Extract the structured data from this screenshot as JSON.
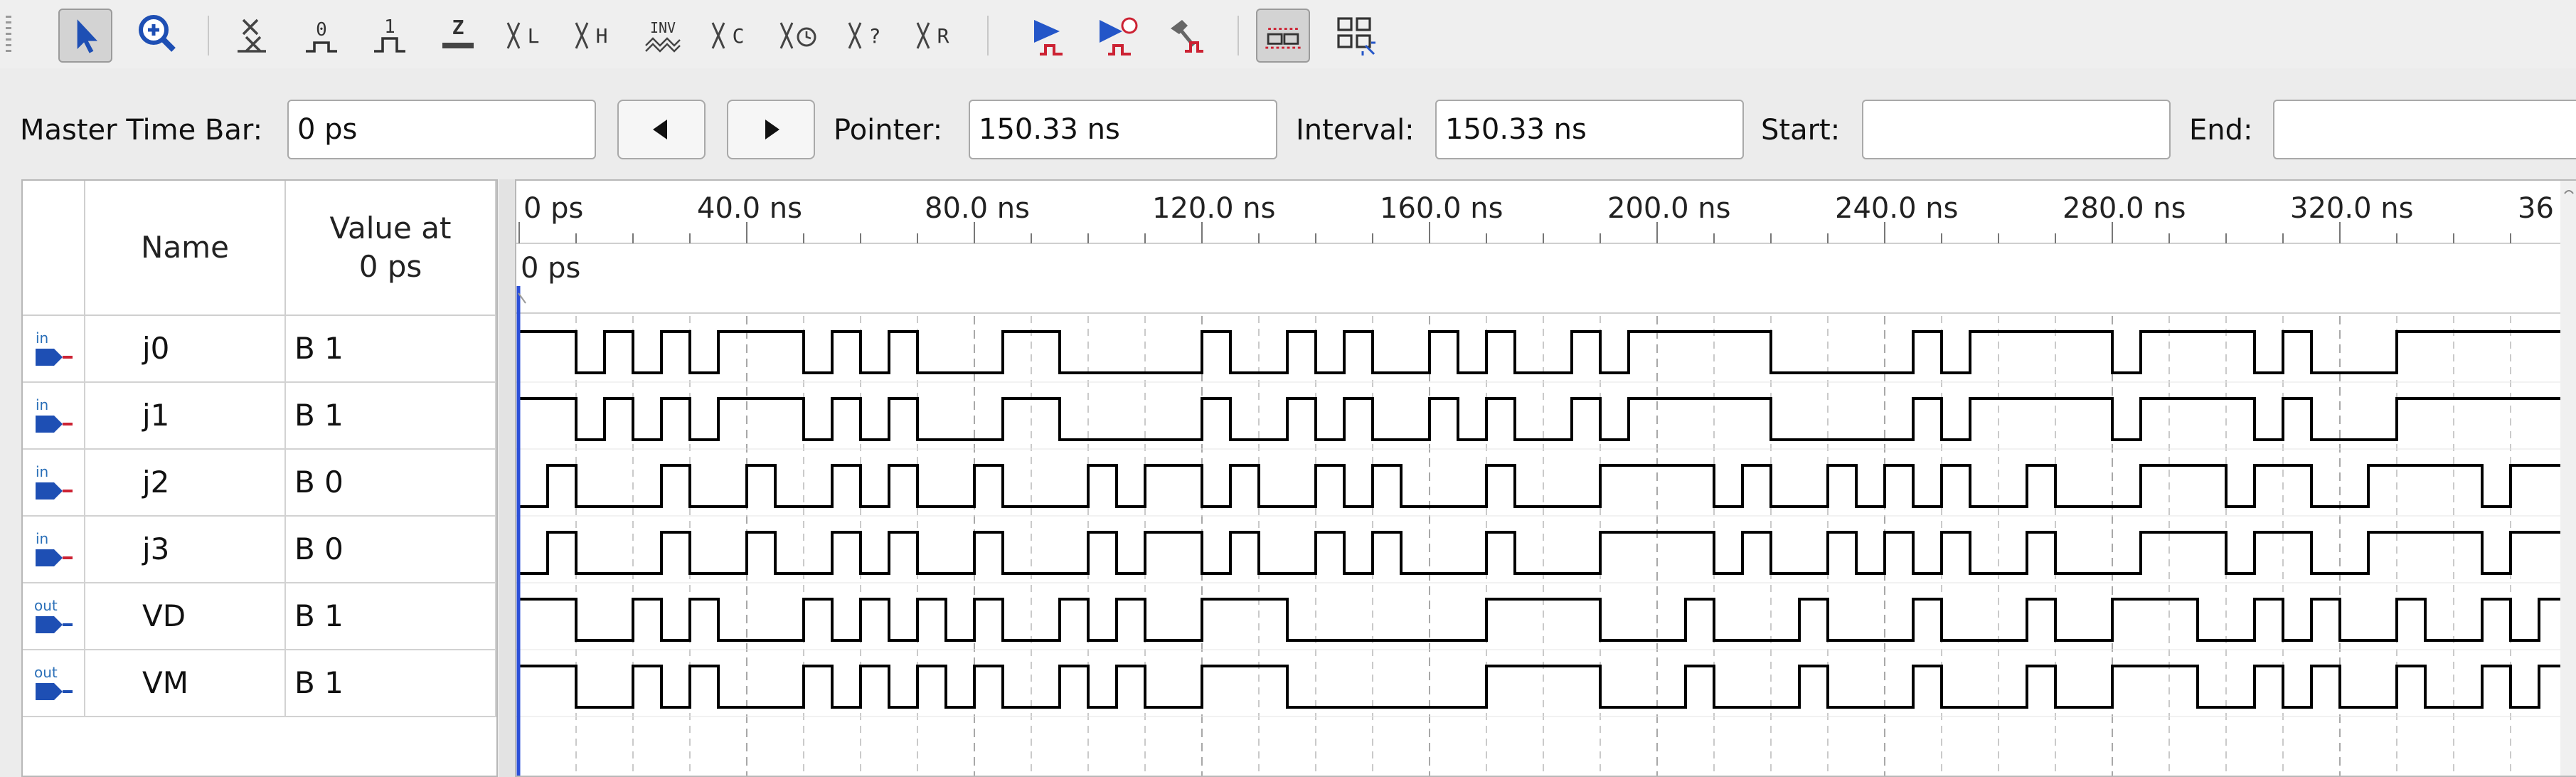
{
  "toolbar": {
    "tools": [
      "selection-tool",
      "zoom-tool",
      "uninitialized",
      "forcing-low",
      "forcing-high",
      "high-impedance",
      "weak-low",
      "weak-high",
      "invert",
      "count-value",
      "clock",
      "random",
      "arbitrary-value",
      "run-functional-simulation",
      "run-timing-simulation",
      "generate-testbench",
      "snap-to-grid",
      "sort-group"
    ],
    "glyphs": {
      "forcing_low": "0",
      "forcing_high": "1",
      "high_z": "Z",
      "weak_low": "L",
      "weak_high": "H",
      "invert": "INV",
      "count": "C",
      "random": "?",
      "arbitrary": "R"
    }
  },
  "timebar": {
    "master_label": "Master Time Bar:",
    "master_value": "0 ps",
    "pointer_label": "Pointer:",
    "pointer_value": "150.33 ns",
    "interval_label": "Interval:",
    "interval_value": "150.33 ns",
    "start_label": "Start:",
    "start_value": "",
    "end_label": "End:",
    "end_value": ""
  },
  "table": {
    "col_name": "Name",
    "col_value": "Value at\n0 ps",
    "signals": [
      {
        "dir": "in",
        "name": "j0",
        "value": "B 1"
      },
      {
        "dir": "in",
        "name": "j1",
        "value": "B 1"
      },
      {
        "dir": "in",
        "name": "j2",
        "value": "B 0"
      },
      {
        "dir": "in",
        "name": "j3",
        "value": "B 0"
      },
      {
        "dir": "out",
        "name": "VD",
        "value": "B 1"
      },
      {
        "dir": "out",
        "name": "VM",
        "value": "B 1"
      }
    ]
  },
  "waveform": {
    "time_labels": [
      "0 ps",
      "40.0 ns",
      "80.0 ns",
      "120.0 ns",
      "160.0 ns",
      "200.0 ns",
      "240.0 ns",
      "280.0 ns",
      "320.0 ns",
      "36"
    ],
    "cursor_label": "0 ps",
    "ns_per_label": 40,
    "visible_end_ns": 356,
    "traces": {
      "j0": [
        [
          0,
          1
        ],
        [
          10,
          0
        ],
        [
          15,
          1
        ],
        [
          20,
          0
        ],
        [
          25,
          1
        ],
        [
          30,
          0
        ],
        [
          35,
          1
        ],
        [
          50,
          0
        ],
        [
          55,
          1
        ],
        [
          60,
          0
        ],
        [
          65,
          1
        ],
        [
          70,
          0
        ],
        [
          85,
          1
        ],
        [
          95,
          0
        ],
        [
          120,
          1
        ],
        [
          125,
          0
        ],
        [
          135,
          1
        ],
        [
          140,
          0
        ],
        [
          145,
          1
        ],
        [
          150,
          0
        ],
        [
          160,
          1
        ],
        [
          165,
          0
        ],
        [
          170,
          1
        ],
        [
          175,
          0
        ],
        [
          185,
          1
        ],
        [
          190,
          0
        ],
        [
          195,
          1
        ],
        [
          220,
          0
        ],
        [
          245,
          1
        ],
        [
          250,
          0
        ],
        [
          255,
          1
        ],
        [
          280,
          0
        ],
        [
          285,
          1
        ],
        [
          305,
          0
        ],
        [
          310,
          1
        ],
        [
          315,
          0
        ],
        [
          330,
          1
        ],
        [
          360,
          0
        ]
      ],
      "j1": [
        [
          0,
          1
        ],
        [
          10,
          0
        ],
        [
          15,
          1
        ],
        [
          20,
          0
        ],
        [
          25,
          1
        ],
        [
          30,
          0
        ],
        [
          35,
          1
        ],
        [
          50,
          0
        ],
        [
          55,
          1
        ],
        [
          60,
          0
        ],
        [
          65,
          1
        ],
        [
          70,
          0
        ],
        [
          85,
          1
        ],
        [
          95,
          0
        ],
        [
          120,
          1
        ],
        [
          125,
          0
        ],
        [
          135,
          1
        ],
        [
          140,
          0
        ],
        [
          145,
          1
        ],
        [
          150,
          0
        ],
        [
          160,
          1
        ],
        [
          165,
          0
        ],
        [
          170,
          1
        ],
        [
          175,
          0
        ],
        [
          185,
          1
        ],
        [
          190,
          0
        ],
        [
          195,
          1
        ],
        [
          220,
          0
        ],
        [
          245,
          1
        ],
        [
          250,
          0
        ],
        [
          255,
          1
        ],
        [
          280,
          0
        ],
        [
          285,
          1
        ],
        [
          305,
          0
        ],
        [
          310,
          1
        ],
        [
          315,
          0
        ],
        [
          330,
          1
        ],
        [
          360,
          0
        ]
      ],
      "j2": [
        [
          0,
          0
        ],
        [
          5,
          1
        ],
        [
          10,
          0
        ],
        [
          25,
          1
        ],
        [
          30,
          0
        ],
        [
          40,
          1
        ],
        [
          45,
          0
        ],
        [
          55,
          1
        ],
        [
          60,
          0
        ],
        [
          65,
          1
        ],
        [
          70,
          0
        ],
        [
          80,
          1
        ],
        [
          85,
          0
        ],
        [
          100,
          1
        ],
        [
          105,
          0
        ],
        [
          110,
          1
        ],
        [
          120,
          0
        ],
        [
          125,
          1
        ],
        [
          130,
          0
        ],
        [
          140,
          1
        ],
        [
          145,
          0
        ],
        [
          150,
          1
        ],
        [
          155,
          0
        ],
        [
          170,
          1
        ],
        [
          175,
          0
        ],
        [
          190,
          1
        ],
        [
          210,
          0
        ],
        [
          215,
          1
        ],
        [
          220,
          0
        ],
        [
          230,
          1
        ],
        [
          235,
          0
        ],
        [
          240,
          1
        ],
        [
          245,
          0
        ],
        [
          250,
          1
        ],
        [
          255,
          0
        ],
        [
          265,
          1
        ],
        [
          270,
          0
        ],
        [
          285,
          1
        ],
        [
          300,
          0
        ],
        [
          305,
          1
        ],
        [
          315,
          0
        ],
        [
          325,
          1
        ],
        [
          345,
          0
        ],
        [
          350,
          1
        ]
      ],
      "j3": [
        [
          0,
          0
        ],
        [
          5,
          1
        ],
        [
          10,
          0
        ],
        [
          25,
          1
        ],
        [
          30,
          0
        ],
        [
          40,
          1
        ],
        [
          45,
          0
        ],
        [
          55,
          1
        ],
        [
          60,
          0
        ],
        [
          65,
          1
        ],
        [
          70,
          0
        ],
        [
          80,
          1
        ],
        [
          85,
          0
        ],
        [
          100,
          1
        ],
        [
          105,
          0
        ],
        [
          110,
          1
        ],
        [
          120,
          0
        ],
        [
          125,
          1
        ],
        [
          130,
          0
        ],
        [
          140,
          1
        ],
        [
          145,
          0
        ],
        [
          150,
          1
        ],
        [
          155,
          0
        ],
        [
          170,
          1
        ],
        [
          175,
          0
        ],
        [
          190,
          1
        ],
        [
          210,
          0
        ],
        [
          215,
          1
        ],
        [
          220,
          0
        ],
        [
          230,
          1
        ],
        [
          235,
          0
        ],
        [
          240,
          1
        ],
        [
          245,
          0
        ],
        [
          250,
          1
        ],
        [
          255,
          0
        ],
        [
          265,
          1
        ],
        [
          270,
          0
        ],
        [
          285,
          1
        ],
        [
          300,
          0
        ],
        [
          305,
          1
        ],
        [
          315,
          0
        ],
        [
          325,
          1
        ],
        [
          345,
          0
        ],
        [
          350,
          1
        ]
      ],
      "VD": [
        [
          0,
          1
        ],
        [
          10,
          0
        ],
        [
          20,
          1
        ],
        [
          25,
          0
        ],
        [
          30,
          1
        ],
        [
          35,
          0
        ],
        [
          50,
          1
        ],
        [
          55,
          0
        ],
        [
          60,
          1
        ],
        [
          65,
          0
        ],
        [
          70,
          1
        ],
        [
          75,
          0
        ],
        [
          80,
          1
        ],
        [
          85,
          0
        ],
        [
          95,
          1
        ],
        [
          100,
          0
        ],
        [
          105,
          1
        ],
        [
          110,
          0
        ],
        [
          120,
          1
        ],
        [
          135,
          0
        ],
        [
          170,
          1
        ],
        [
          190,
          0
        ],
        [
          205,
          1
        ],
        [
          210,
          0
        ],
        [
          225,
          1
        ],
        [
          230,
          0
        ],
        [
          245,
          1
        ],
        [
          250,
          0
        ],
        [
          265,
          1
        ],
        [
          270,
          0
        ],
        [
          280,
          1
        ],
        [
          295,
          0
        ],
        [
          305,
          1
        ],
        [
          310,
          0
        ],
        [
          315,
          1
        ],
        [
          320,
          0
        ],
        [
          330,
          1
        ],
        [
          335,
          0
        ],
        [
          345,
          1
        ],
        [
          350,
          0
        ],
        [
          355,
          1
        ]
      ],
      "VM": [
        [
          0,
          1
        ],
        [
          10,
          0
        ],
        [
          20,
          1
        ],
        [
          25,
          0
        ],
        [
          30,
          1
        ],
        [
          35,
          0
        ],
        [
          50,
          1
        ],
        [
          55,
          0
        ],
        [
          60,
          1
        ],
        [
          65,
          0
        ],
        [
          70,
          1
        ],
        [
          75,
          0
        ],
        [
          80,
          1
        ],
        [
          85,
          0
        ],
        [
          95,
          1
        ],
        [
          100,
          0
        ],
        [
          105,
          1
        ],
        [
          110,
          0
        ],
        [
          120,
          1
        ],
        [
          135,
          0
        ],
        [
          170,
          1
        ],
        [
          190,
          0
        ],
        [
          205,
          1
        ],
        [
          210,
          0
        ],
        [
          225,
          1
        ],
        [
          230,
          0
        ],
        [
          245,
          1
        ],
        [
          250,
          0
        ],
        [
          265,
          1
        ],
        [
          270,
          0
        ],
        [
          280,
          1
        ],
        [
          295,
          0
        ],
        [
          305,
          1
        ],
        [
          310,
          0
        ],
        [
          315,
          1
        ],
        [
          320,
          0
        ],
        [
          330,
          1
        ],
        [
          335,
          0
        ],
        [
          345,
          1
        ],
        [
          350,
          0
        ],
        [
          355,
          1
        ]
      ]
    }
  },
  "colors": {
    "icon_blue": "#1e4fb4",
    "cursor_blue": "#2b4fd8",
    "wave_line": "#000000",
    "grid_dash": "#bdbdbd"
  }
}
